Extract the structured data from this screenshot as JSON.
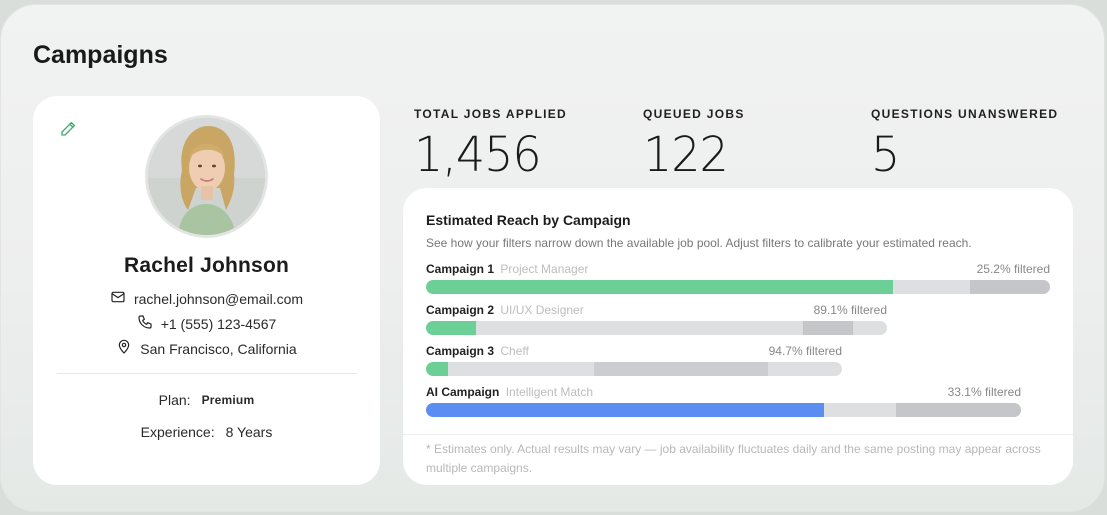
{
  "page": {
    "title": "Campaigns"
  },
  "profile": {
    "name": "Rachel Johnson",
    "email": "rachel.johnson@email.com",
    "phone": "+1 (555) 123-4567",
    "location": "San Francisco, California",
    "plan_label": "Plan:",
    "plan_value": "Premium",
    "experience_label": "Experience:",
    "experience_value": "8 Years"
  },
  "stats": [
    {
      "label": "TOTAL JOBS APPLIED",
      "value": "1,456"
    },
    {
      "label": "QUEUED JOBS",
      "value": "122"
    },
    {
      "label": "QUESTIONS UNANSWERED",
      "value": "5"
    }
  ],
  "reach": {
    "title": "Estimated Reach by Campaign",
    "subtitle": "See how your filters narrow down the available job pool. Adjust filters to calibrate your estimated reach.",
    "campaigns": [
      {
        "name": "Campaign 1",
        "role": "Project Manager",
        "filtered": "25.2% filtered",
        "color": "#6ccf96",
        "fill_fraction": 0.748
      },
      {
        "name": "Campaign 2",
        "role": "UI/UX Designer",
        "filtered": "89.1% filtered",
        "color": "#6ccf96",
        "fill_fraction": 0.109
      },
      {
        "name": "Campaign 3",
        "role": "Cheff",
        "filtered": "94.7% filtered",
        "color": "#6ccf96",
        "fill_fraction": 0.053
      },
      {
        "name": "AI Campaign",
        "role": "Intelligent Match",
        "filtered": "33.1% filtered",
        "color": "#5b8ef0",
        "fill_fraction": 0.669
      }
    ],
    "note": "* Estimates only. Actual results may vary — job availability fluctuates daily and the same posting may appear across multiple campaigns."
  },
  "icons": {
    "edit": "pencil-icon",
    "email": "mail-icon",
    "phone": "phone-icon",
    "location": "location-pin-icon"
  }
}
